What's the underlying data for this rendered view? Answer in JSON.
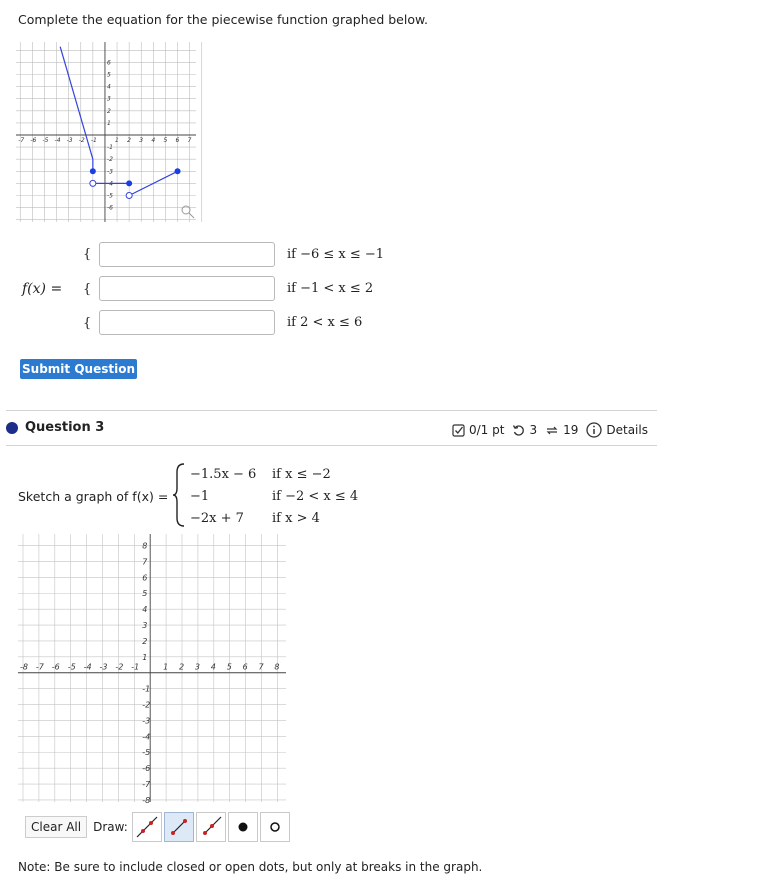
{
  "prompt": "Complete the equation for the piecewise function graphed below.",
  "graph1": {
    "x_ticks": [
      "-7",
      "-6",
      "-5",
      "-4",
      "-3",
      "-2",
      "-1",
      "1",
      "2",
      "3",
      "4",
      "5",
      "6",
      "7"
    ],
    "y_ticks": [
      "6",
      "5",
      "4",
      "3",
      "2",
      "1",
      "-1",
      "-2",
      "-3",
      "-4",
      "-5",
      "-6"
    ],
    "line_color": "#3344dd",
    "zoom_icon": "magnifier-icon"
  },
  "equation": {
    "lhs": "f(x) =",
    "brace": "{",
    "rows": [
      {
        "condition": "if −6 ≤ x ≤ −1",
        "value": ""
      },
      {
        "condition": "if −1 < x ≤ 2",
        "value": ""
      },
      {
        "condition": "if 2 < x ≤ 6",
        "value": ""
      }
    ]
  },
  "submit_label": "Submit Question",
  "question3": {
    "label": "Question 3",
    "score": "0/1 pt",
    "retries": "3",
    "submissions": "19",
    "details": "Details",
    "sketch_label": "Sketch a graph of f(x) =",
    "pieces": [
      {
        "expr": "−1.5x − 6",
        "cond": "if x ≤ −2"
      },
      {
        "expr": "−1",
        "cond": "if −2 < x ≤ 4"
      },
      {
        "expr": "−2x + 7",
        "cond": "if x > 4"
      }
    ]
  },
  "graph2": {
    "x_ticks": [
      "-8",
      "-7",
      "-6",
      "-5",
      "-4",
      "-3",
      "-2",
      "-1",
      "1",
      "2",
      "3",
      "4",
      "5",
      "6",
      "7",
      "8"
    ],
    "y_ticks": [
      "8",
      "7",
      "6",
      "5",
      "4",
      "3",
      "2",
      "1",
      "-1",
      "-2",
      "-3",
      "-4",
      "-5",
      "-6",
      "-7",
      "-8"
    ]
  },
  "toolbar": {
    "clear_label": "Clear All",
    "draw_label": "Draw:",
    "tools": [
      "line-tool-icon",
      "segment-tool-icon",
      "ray-tool-icon",
      "closed-dot-icon",
      "open-dot-icon"
    ]
  },
  "note": "Note: Be sure to include closed or open dots, but only at breaks in the graph."
}
